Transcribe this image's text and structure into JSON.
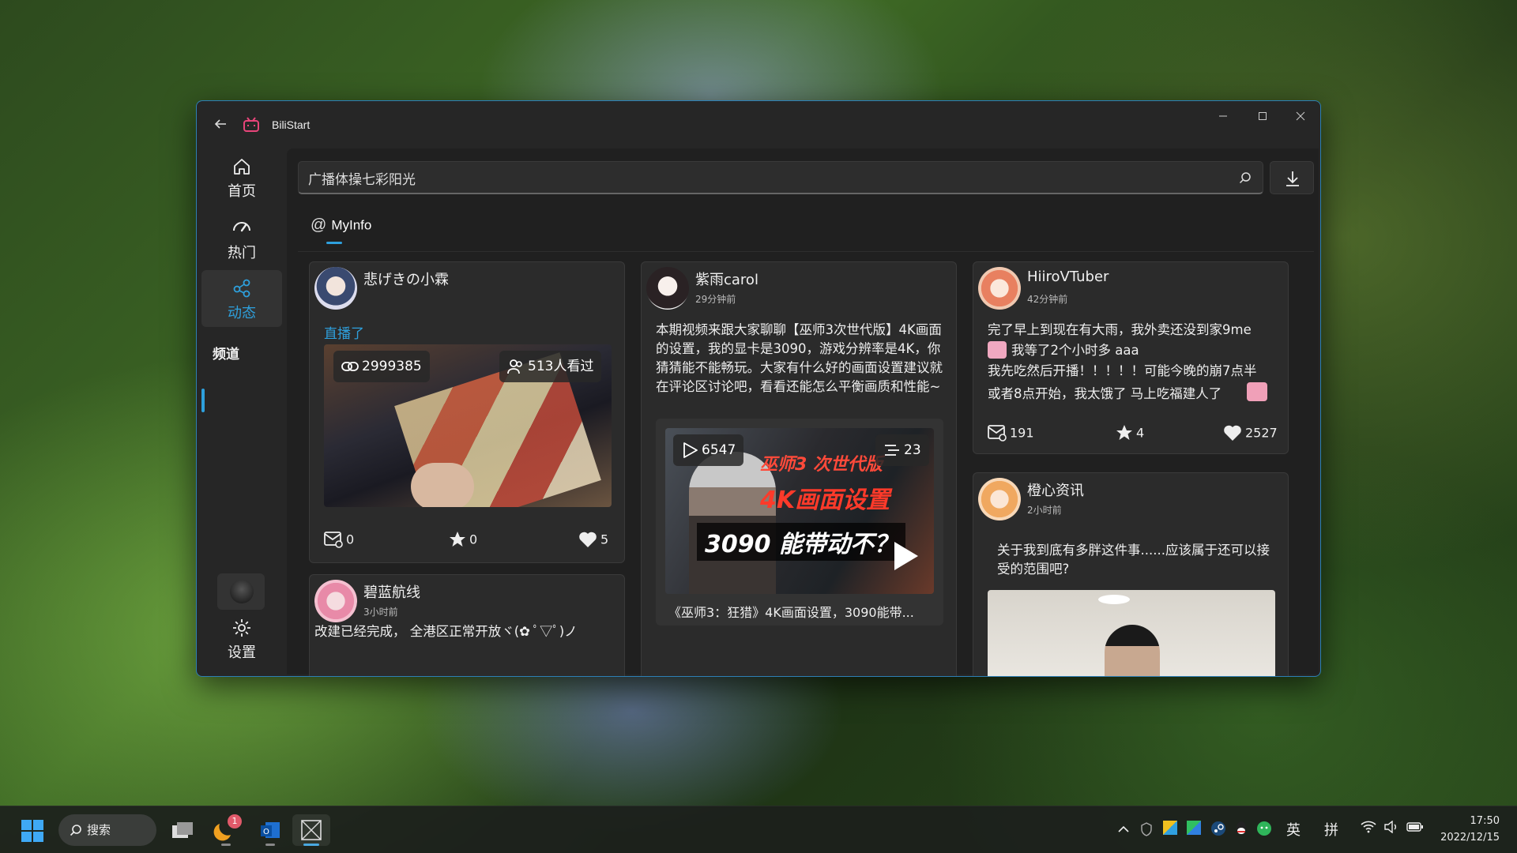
{
  "window": {
    "title": "BiliStart",
    "accent_color": "#2ea0dd"
  },
  "sidebar": {
    "items": [
      {
        "label": "首页",
        "icon": "home-icon"
      },
      {
        "label": "热门",
        "icon": "trending-icon"
      },
      {
        "label": "动态",
        "icon": "dynamic-icon",
        "active": true
      },
      {
        "label": "频道"
      }
    ],
    "settings_label": "设置"
  },
  "search": {
    "value": "广播体操七彩阳光"
  },
  "tab": {
    "label": "MyInfo"
  },
  "cards": {
    "c1": {
      "user": "悲げきの小霖",
      "live_label": "直播了",
      "pill_left": "2999385",
      "pill_right": "513人看过",
      "share": "0",
      "star": "0",
      "like": "5"
    },
    "c2": {
      "user": "碧蓝航线",
      "time": "3小时前",
      "text": "改建已经完成， 全港区正常开放ヾ(✿ ﾟ▽ﾟ)ノ"
    },
    "c3": {
      "user": "紫雨carol",
      "time": "29分钟前",
      "text": "本期视频来跟大家聊聊【巫师3次世代版】4K画面的设置，我的显卡是3090，游戏分辨率是4K，你猜猜能不能畅玩。大家有什么好的画面设置建议就在评论区讨论吧，看看还能怎么平衡画质和性能~",
      "play_count": "6547",
      "danmaku_count": "23",
      "thumb_line1": "巫师3 次世代版",
      "thumb_line2": "4K画面设置",
      "thumb_line3": "3090 能带动不？",
      "video_title": "《巫师3：狂猎》4K画面设置，3090能带..."
    },
    "c4": {
      "user": "HiiroVTuber",
      "time": "42分钟前",
      "line1": "完了早上到现在有大雨，我外卖还没到家9me",
      "line2": "我等了2个小时多 aaa",
      "line3": "我先吃然后开播！！！！！可能今晚的崩7点半",
      "line4": "或者8点开始，我太饿了 马上吃福建人了",
      "share": "191",
      "star": "4",
      "like": "2527"
    },
    "c5": {
      "user": "橙心资讯",
      "time": "2小时前",
      "text": "关于我到底有多胖这件事......应该属于还可以接受的范围吧?"
    }
  },
  "taskbar": {
    "search_label": "搜索",
    "badge": "1",
    "ime_lang": "英",
    "ime_mode": "拼",
    "time": "17:50",
    "date": "2022/12/15"
  }
}
